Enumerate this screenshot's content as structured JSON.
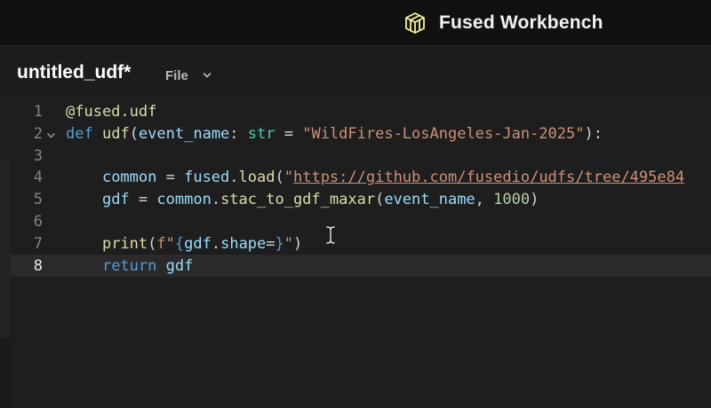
{
  "header": {
    "title": "Fused Workbench",
    "logo_icon": "fused-cube-logo"
  },
  "tab": {
    "title": "untitled_udf*",
    "file_menu_label": "File"
  },
  "editor": {
    "active_line": 8,
    "line_numbers": [
      "1",
      "2",
      "3",
      "4",
      "5",
      "6",
      "7",
      "8"
    ],
    "lines": [
      [
        {
          "t": "@fused.udf",
          "c": "dec"
        }
      ],
      [
        {
          "t": "def",
          "c": "kw"
        },
        {
          "t": " ",
          "c": "punc"
        },
        {
          "t": "udf",
          "c": "fn"
        },
        {
          "t": "(",
          "c": "punc"
        },
        {
          "t": "event_name",
          "c": "var"
        },
        {
          "t": ": ",
          "c": "punc"
        },
        {
          "t": "str",
          "c": "type"
        },
        {
          "t": " = ",
          "c": "punc"
        },
        {
          "t": "\"WildFires-LosAngeles-Jan-2025\"",
          "c": "str"
        },
        {
          "t": "):",
          "c": "punc"
        }
      ],
      [],
      [
        {
          "t": "    ",
          "c": "punc"
        },
        {
          "t": "common",
          "c": "var"
        },
        {
          "t": " = ",
          "c": "punc"
        },
        {
          "t": "fused",
          "c": "var"
        },
        {
          "t": ".",
          "c": "punc"
        },
        {
          "t": "load",
          "c": "fn"
        },
        {
          "t": "(",
          "c": "punc"
        },
        {
          "t": "\"",
          "c": "str"
        },
        {
          "t": "https://github.com/fusedio/udfs/tree/495e84",
          "c": "url"
        }
      ],
      [
        {
          "t": "    ",
          "c": "punc"
        },
        {
          "t": "gdf",
          "c": "var"
        },
        {
          "t": " = ",
          "c": "punc"
        },
        {
          "t": "common",
          "c": "var"
        },
        {
          "t": ".",
          "c": "punc"
        },
        {
          "t": "stac_to_gdf_maxar",
          "c": "fn"
        },
        {
          "t": "(",
          "c": "punc"
        },
        {
          "t": "event_name",
          "c": "var"
        },
        {
          "t": ", ",
          "c": "punc"
        },
        {
          "t": "1000",
          "c": "num"
        },
        {
          "t": ")",
          "c": "punc"
        }
      ],
      [],
      [
        {
          "t": "    ",
          "c": "punc"
        },
        {
          "t": "print",
          "c": "fn"
        },
        {
          "t": "(",
          "c": "punc"
        },
        {
          "t": "f\"",
          "c": "str"
        },
        {
          "t": "{",
          "c": "brace"
        },
        {
          "t": "gdf",
          "c": "var"
        },
        {
          "t": ".",
          "c": "punc"
        },
        {
          "t": "shape",
          "c": "var"
        },
        {
          "t": "=",
          "c": "punc"
        },
        {
          "t": "}",
          "c": "brace"
        },
        {
          "t": "\"",
          "c": "str"
        },
        {
          "t": ")",
          "c": "punc"
        }
      ],
      [
        {
          "t": "    ",
          "c": "punc"
        },
        {
          "t": "return",
          "c": "kw"
        },
        {
          "t": " ",
          "c": "punc"
        },
        {
          "t": "gdf",
          "c": "var"
        }
      ]
    ]
  },
  "colors": {
    "background": "#1e1e1f",
    "header_bg": "#111112",
    "keyword": "#569cd6",
    "string": "#ce9178",
    "function": "#dcdcaa",
    "variable": "#9cdcfe",
    "type": "#4ec9b0",
    "number": "#b5cea8",
    "logo": "#f5f29a"
  }
}
